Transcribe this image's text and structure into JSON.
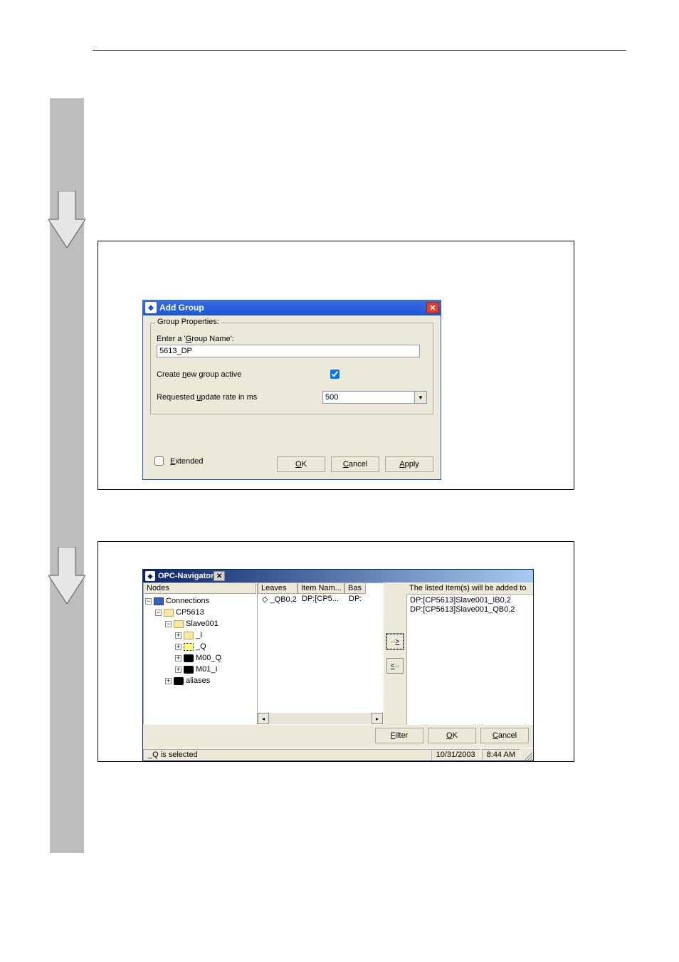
{
  "sidebar": {
    "arrows": 2
  },
  "add_group": {
    "title": "Add Group",
    "groupbox_legend": "Group Properties:",
    "name_label": "Enter a 'Group Name':",
    "name_value": "5613_DP",
    "active_label": "Create new group active",
    "active_checked": true,
    "rate_label": "Requested update rate in ms",
    "rate_value": "500",
    "extended_label": "Extended",
    "extended_checked": false,
    "buttons": {
      "ok": "OK",
      "cancel": "Cancel",
      "apply": "Apply"
    }
  },
  "opc": {
    "title": "OPC-Navigator",
    "tree_header": "Nodes",
    "tree": {
      "connections": "Connections",
      "cp5613": "CP5613",
      "slave001": "Slave001",
      "node_I": "_I",
      "node_Q": "_Q",
      "node_M00Q": "M00_Q",
      "node_M01I": "M01_I",
      "aliases": "aliases"
    },
    "list_headers": {
      "leaves": "Leaves",
      "itemname": "Item Nam...",
      "bas": "Bas"
    },
    "list_row": {
      "leaves": "_QB0,2",
      "itemname": "DP:[CP5...",
      "bas": "DP:"
    },
    "move_right": "-->",
    "move_left": "<--",
    "added_header": "The listed Item(s) will be added to",
    "added_items": [
      "DP:[CP5613]Slave001_IB0,2",
      "DP:[CP5613]Slave001_QB0,2"
    ],
    "buttons": {
      "filter": "Filter",
      "ok": "OK",
      "cancel": "Cancel"
    },
    "status_text": "_Q is selected",
    "status_date": "10/31/2003",
    "status_time": "8:44 AM"
  }
}
